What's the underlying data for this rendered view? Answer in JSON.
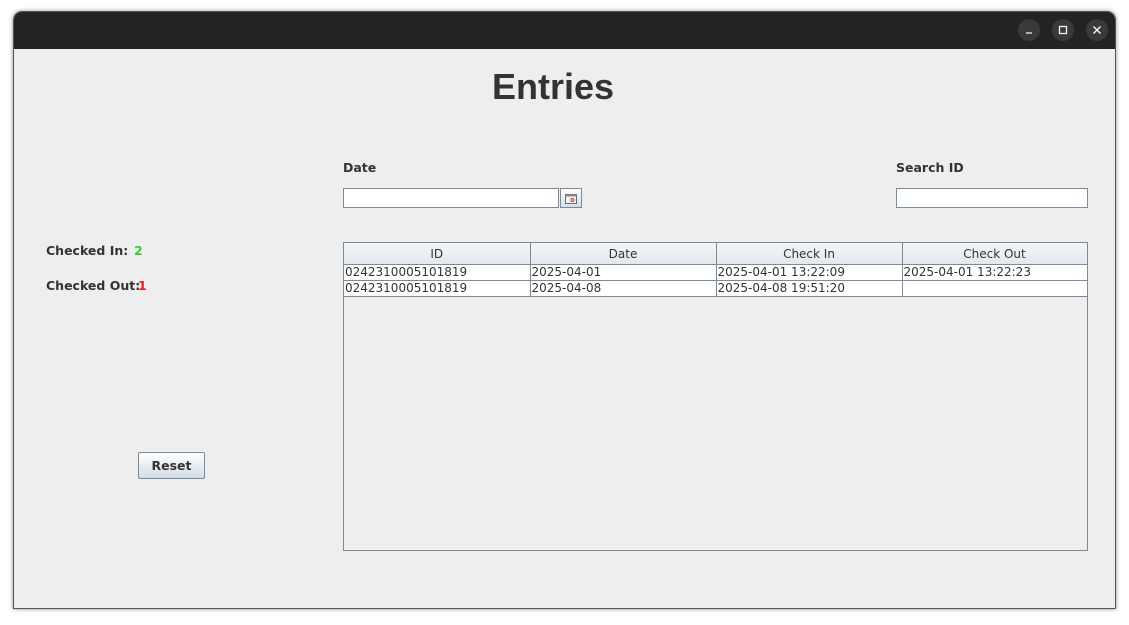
{
  "window": {
    "controls": {
      "minimize": "minimize-icon",
      "maximize": "maximize-icon",
      "close": "close-icon"
    }
  },
  "page": {
    "title": "Entries"
  },
  "filters": {
    "date_label": "Date",
    "date_value": "",
    "calendar_icon": "calendar-icon",
    "search_label": "Search ID",
    "search_value": ""
  },
  "stats": {
    "checked_in_label": "Checked In:",
    "checked_in_value": "2",
    "checked_in_color": "#33cc33",
    "checked_out_label": "Checked Out:",
    "checked_out_value": "1",
    "checked_out_color": "#e02020"
  },
  "actions": {
    "reset_label": "Reset"
  },
  "table": {
    "columns": [
      "ID",
      "Date",
      "Check In",
      "Check Out"
    ],
    "rows": [
      [
        "0242310005101819",
        "2025-04-01",
        "2025-04-01 13:22:09",
        "2025-04-01 13:22:23"
      ],
      [
        "0242310005101819",
        "2025-04-08",
        "2025-04-08 19:51:20",
        ""
      ]
    ]
  }
}
